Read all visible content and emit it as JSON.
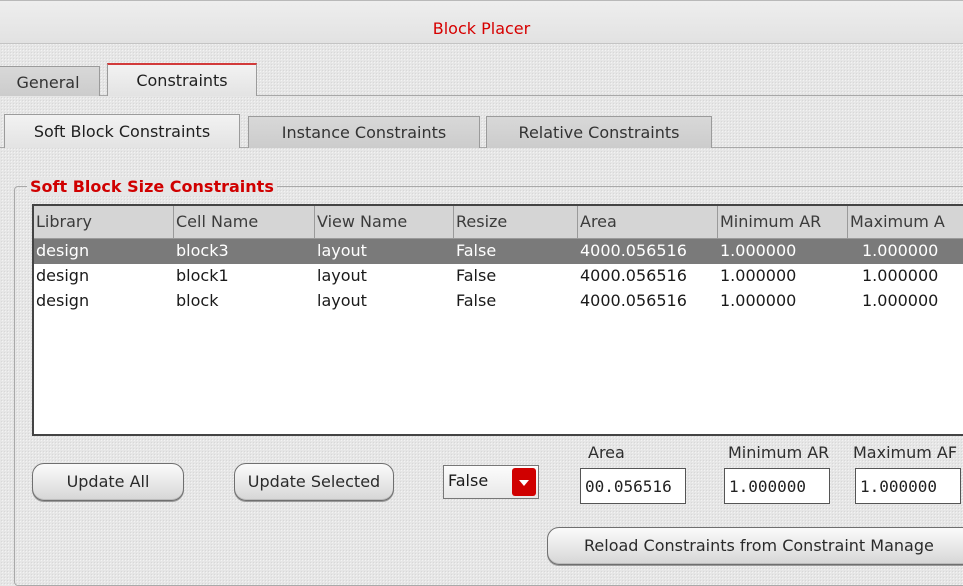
{
  "window": {
    "title": "Block Placer"
  },
  "main_tabs": [
    {
      "label": "General"
    },
    {
      "label": "Constraints"
    }
  ],
  "sub_tabs": [
    {
      "label": "Soft Block Constraints"
    },
    {
      "label": "Instance Constraints"
    },
    {
      "label": "Relative Constraints"
    }
  ],
  "group": {
    "title": "Soft Block Size Constraints"
  },
  "table": {
    "columns": [
      "Library",
      "Cell Name",
      "View Name",
      "Resize",
      "Area",
      "Minimum AR",
      "Maximum A"
    ],
    "rows": [
      [
        "design",
        "block3",
        "layout",
        "False",
        "4000.056516",
        "1.000000",
        "1.000000"
      ],
      [
        "design",
        "block1",
        "layout",
        "False",
        "4000.056516",
        "1.000000",
        "1.000000"
      ],
      [
        "design",
        "block",
        "layout",
        "False",
        "4000.056516",
        "1.000000",
        "1.000000"
      ]
    ]
  },
  "controls": {
    "update_all": "Update All",
    "update_selected": "Update Selected",
    "resize_select_value": "False",
    "area_label": "Area",
    "area_value": "00.056516",
    "min_ar_label": "Minimum AR",
    "min_ar_value": "1.000000",
    "max_ar_label": "Maximum AF",
    "max_ar_value": "1.000000",
    "reload": "Reload Constraints from Constraint Manage"
  }
}
